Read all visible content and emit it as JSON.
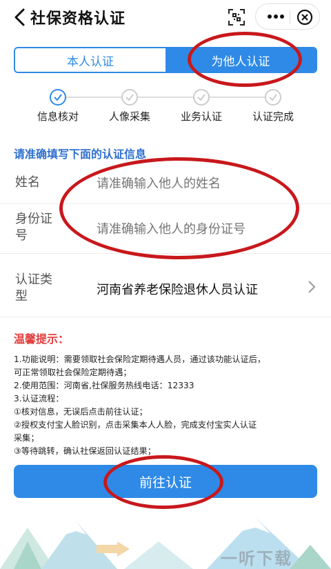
{
  "header": {
    "title": "社保资格认证",
    "icons": [
      "back-arrow-icon",
      "scan-icon",
      "more-icon",
      "close-icon"
    ]
  },
  "tabs": [
    {
      "label": "本人认证",
      "active": false
    },
    {
      "label": "为他人认证",
      "active": true
    }
  ],
  "steps": [
    {
      "label": "信息核对",
      "done": true
    },
    {
      "label": "人像采集",
      "done": false
    },
    {
      "label": "业务认证",
      "done": false
    },
    {
      "label": "认证完成",
      "done": false
    }
  ],
  "form": {
    "heading": "请准确填写下面的认证信息",
    "name_label": "姓名",
    "name_placeholder": "请准确输入他人的姓名",
    "id_label_1": "身份证",
    "id_label_2": "号",
    "id_placeholder": "请准确输入他人的身份证号",
    "type_label_1": "认证类",
    "type_label_2": "型",
    "type_value": "河南省养老保险退休人员认证"
  },
  "tips": {
    "title": "温馨提示：",
    "lines": [
      "1.功能说明：需要领取社会保险定期待遇人员，通过该功能认证后，",
      "可正常领取社会保险定期待遇；",
      "2.使用范围：河南省,社保服务热线电话：12333",
      "3.认证流程：",
      "①核对信息，无误后点击前往认证；",
      "②授权支付宝人脸识别，点击采集本人人脸，完成支付宝实人认证",
      "采集；",
      "③等待跳转，确认社保返回认证结果；"
    ]
  },
  "submit_label": "前往认证",
  "watermark": "一听下载",
  "colors": {
    "primary": "#2e8ae6",
    "annotation": "#c8181c",
    "tip_title": "#e23b3b"
  }
}
